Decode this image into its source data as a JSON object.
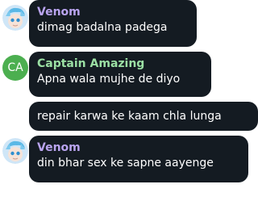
{
  "colors": {
    "background": "#ffffff",
    "bubble": "#141b22",
    "text": "#ffffff",
    "venom_name": "#b9a4ef",
    "captain_name": "#9be0a4",
    "captain_avatar": "#4caf50"
  },
  "messages": [
    {
      "author": "Venom",
      "avatar_icon": "venom-avatar-icon",
      "text": "dimag badalna padega"
    },
    {
      "author": "Captain Amazing",
      "avatar_initials": "CA",
      "text": "Apna wala mujhe de diyo"
    },
    {
      "text": "repair karwa ke kaam chla lunga"
    },
    {
      "author": "Venom",
      "avatar_icon": "venom-avatar-icon",
      "text": "din bhar sex ke sapne aayenge"
    }
  ]
}
